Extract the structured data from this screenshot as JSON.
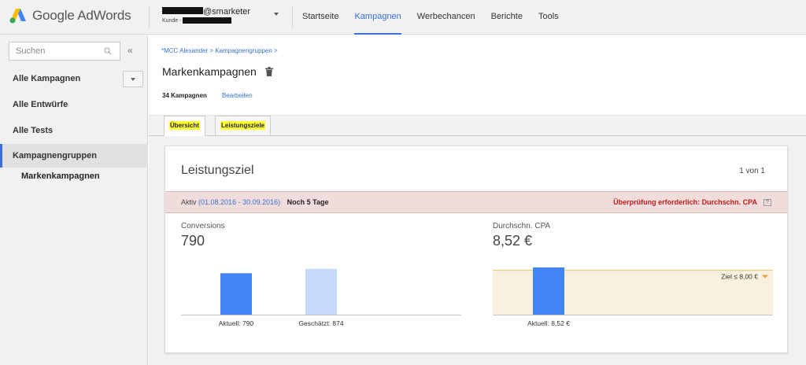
{
  "app": {
    "logo_text": "Google AdWords"
  },
  "account": {
    "email_suffix": "@smarketer",
    "customer_label": "Kunde -"
  },
  "nav": {
    "items": [
      "Startseite",
      "Kampagnen",
      "Werbechancen",
      "Berichte",
      "Tools"
    ],
    "active": "Kampagnen"
  },
  "sidebar": {
    "search_placeholder": "Suchen",
    "collapse_symbol": "«",
    "items": [
      {
        "label": "Alle Kampagnen"
      },
      {
        "label": "Alle Entwürfe"
      },
      {
        "label": "Alle Tests"
      },
      {
        "label": "Kampagnengruppen"
      }
    ],
    "sub_item": "Markenkampagnen"
  },
  "main": {
    "breadcrumb": [
      "*MCC Alexander",
      "Kampagnengruppen"
    ],
    "title": "Markenkampagnen",
    "campaign_count": "34 Kampagnen",
    "edit_label": "Bearbeiten",
    "tabs": [
      {
        "label": "Übersicht"
      },
      {
        "label": "Leistungsziele"
      }
    ]
  },
  "card": {
    "title": "Leistungsziel",
    "pager": "1 von 1",
    "status_label": "Aktiv",
    "status_dates": "(01.08.2016 - 30.09.2016)",
    "status_remaining": "Noch 5 Tage",
    "status_warning": "Überprüfung erforderlich: Durchschn. CPA",
    "help_symbol": "?",
    "conversions": {
      "label": "Conversions",
      "value": "790"
    },
    "cpa": {
      "label": "Durchschn. CPA",
      "value": "8,52 €"
    }
  },
  "colors": {
    "accent_blue": "#3a70d8",
    "bar_actual": "#4285f4",
    "bar_estimated": "#c6dafc",
    "goal_band": "#f8f1df",
    "goal_line": "#e8c36a",
    "warning_red": "#c21b1b",
    "highlight_yellow": "#ffff33"
  },
  "chart_data": [
    {
      "type": "bar",
      "categories": [
        "Aktuell: 790",
        "Geschätzt: 874"
      ],
      "values": [
        790,
        874
      ],
      "title": "",
      "xlabel": "",
      "ylabel": "",
      "grid": false
    },
    {
      "type": "bar",
      "categories": [
        "Aktuell: 8,52 €"
      ],
      "values": [
        8.52
      ],
      "goal_label": "Ziel ≤ 8,00 €",
      "goal_value": 8.0,
      "title": "",
      "xlabel": "",
      "ylabel": "",
      "grid": false
    }
  ]
}
